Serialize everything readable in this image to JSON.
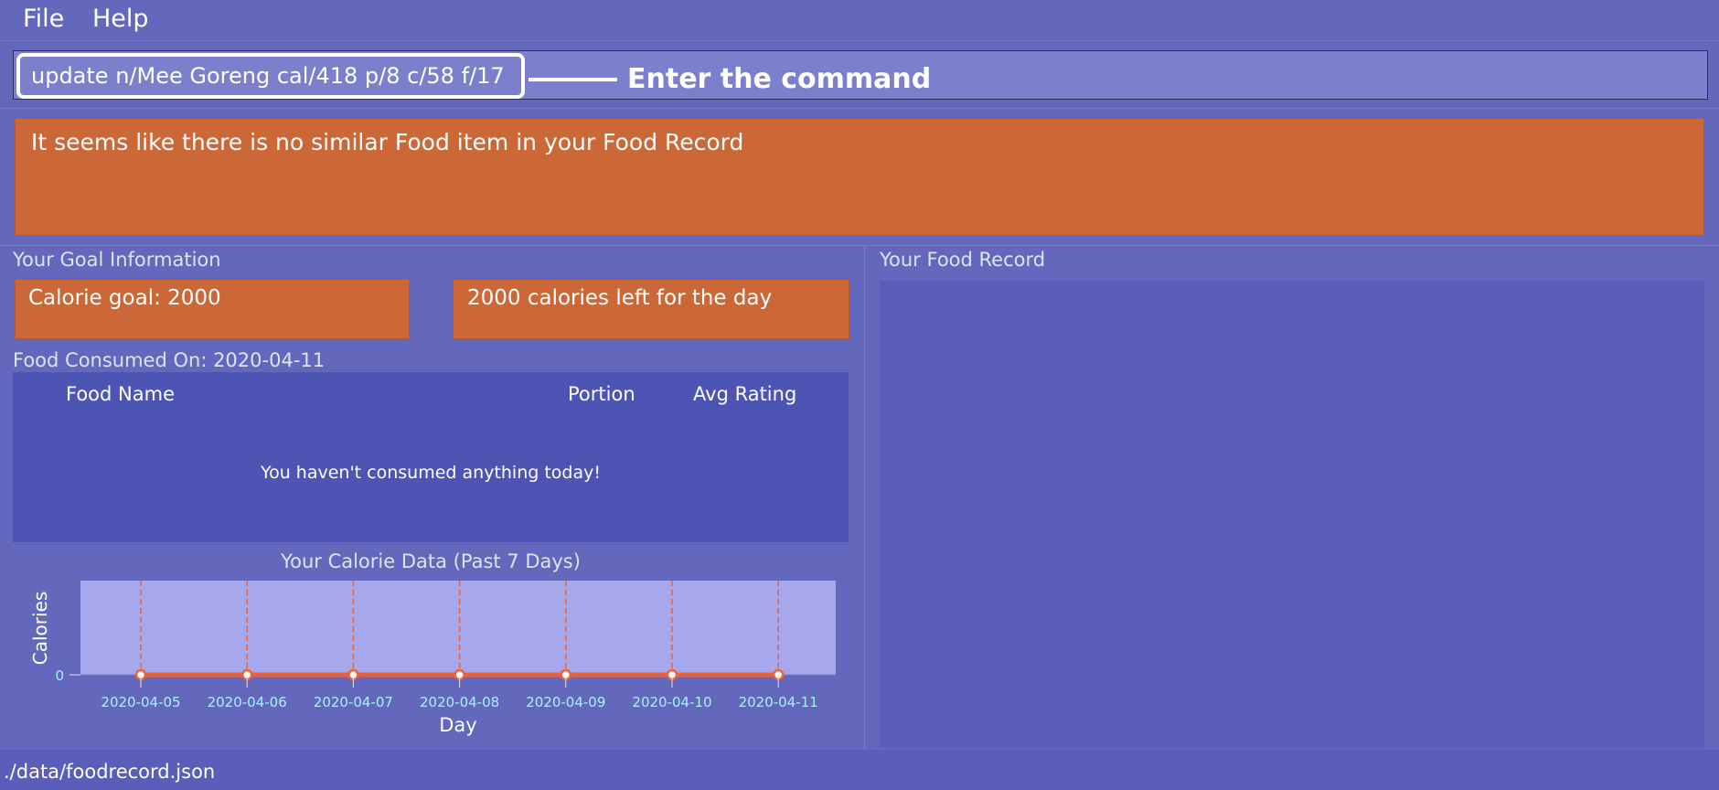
{
  "menu": {
    "file": "File",
    "help": "Help"
  },
  "command": {
    "value": "update n/Mee Goreng cal/418 p/8 c/58 f/17",
    "annotation": "Enter the command"
  },
  "result": {
    "message": "It seems like there is no similar Food item in your Food Record"
  },
  "goal_panel": {
    "title": "Your Goal Information",
    "calorie_goal": "Calorie goal: 2000",
    "calories_left": "2000 calories left for the day"
  },
  "consumed": {
    "title": "Food Consumed On: 2020-04-11",
    "columns": [
      "Food Name",
      "Portion",
      "Avg Rating"
    ],
    "empty_message": "You haven't consumed anything today!"
  },
  "chart_data": {
    "type": "line",
    "title": "Your Calorie Data (Past 7 Days)",
    "xlabel": "Day",
    "ylabel": "Calories",
    "categories": [
      "2020-04-05",
      "2020-04-06",
      "2020-04-07",
      "2020-04-08",
      "2020-04-09",
      "2020-04-10",
      "2020-04-11"
    ],
    "series": [
      {
        "values": [
          0,
          0,
          0,
          0,
          0,
          0,
          0
        ]
      }
    ],
    "y_ticks": [
      "0"
    ],
    "colors": {
      "line": "#e8623a",
      "plot_bg": "#a7a7ec",
      "gridline": "#e8623a",
      "tick_label": "#a9f0ff"
    }
  },
  "record_panel": {
    "title": "Your Food Record"
  },
  "status": {
    "path": "./data/foodrecord.json"
  },
  "colors": {
    "background": "#6368bd",
    "accent": "#cc6838",
    "table_bg": "#4e54b3",
    "list_bg": "#5a5db9"
  }
}
